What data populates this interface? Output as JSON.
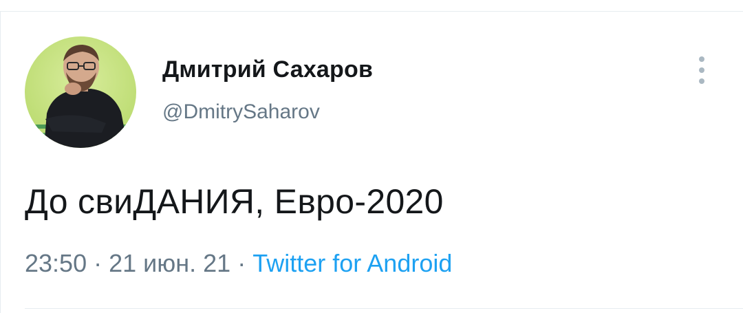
{
  "tweet": {
    "author": {
      "display_name": "Дмитрий Сахаров",
      "handle": "@DmitrySaharov",
      "avatar_icon": "user-avatar-photo"
    },
    "more_icon": "vertical-ellipsis-icon",
    "text": "До свиДАНИЯ, Евро-2020",
    "time": "23:50",
    "separator": "·",
    "date": "21 июн. 21",
    "source": "Twitter for Android"
  },
  "colors": {
    "text_primary": "#14171a",
    "text_secondary": "#657786",
    "link": "#1da1f2",
    "divider": "#e6ecf0",
    "icon_muted": "#aab8c2"
  }
}
